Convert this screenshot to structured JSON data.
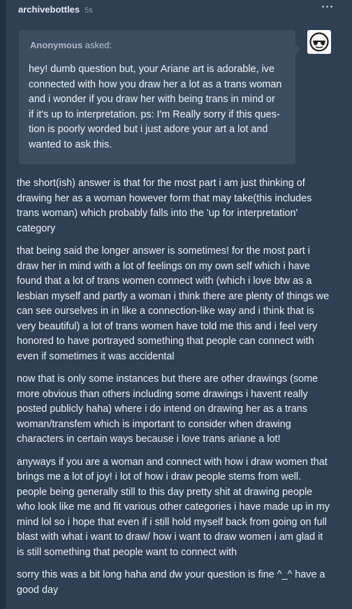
{
  "post": {
    "username": "archivebottles",
    "timestamp": "5s"
  },
  "ask": {
    "asker": "Anonymous",
    "asked_suffix": "asked:",
    "question_lines": [
      "hey! dumb question but, your Ariane art is adorable, ive",
      "connected with how you draw her a lot as a trans woman",
      "and i wonder if you draw her with being trans in mind or",
      "if it's up to interpretation. ps: I'm Really sorry if this ques-",
      "tion is poorly worded but i just adore your art a lot and",
      "wanted to ask this."
    ]
  },
  "answer": {
    "paragraphs": [
      [
        "the short(ish) answer is that for the most part i am just thinking of",
        "drawing her as a woman however form that may take(this includes",
        "trans woman) which probably falls into the 'up for interpretation'",
        "category"
      ],
      [
        "that being said the longer answer is sometimes! for the most part i",
        "draw her in mind with a lot of feelings on my own self which i have",
        "found that a lot of trans women connect with (which i love btw as a",
        "lesbian myself and partly a woman i think there are plenty of things we",
        "can see ourselves in in like a connection-like way and i think that is",
        "very beautiful) a lot of trans women have told me this and i feel very",
        "honored to have portrayed something that people can connect with",
        "even if sometimes it was accidental"
      ],
      [
        "now that is only some instances but there are other drawings (some",
        "more obvious than others including some drawings i havent really",
        "posted publicly haha) where i do intend on drawing her as a trans",
        "woman/transfem which is important to consider when drawing",
        "characters in certain ways because i love trans ariane a lot!"
      ],
      [
        "anyways if you are a woman and connect with how i draw women that",
        "brings me a lot of joy! i lot of how i draw people stems from well.",
        "people being generally still to this day pretty shit at drawing people",
        "who look like me and fit various other categories i have made up in my",
        "mind lol so i hope that even if i still hold myself back from going on full",
        "blast with what i want to draw/ how i want to draw women i am glad it",
        "is still something that people want to connect with"
      ],
      [
        "sorry this was a bit long haha and dw your question is fine ^_^ have a",
        "good day"
      ]
    ]
  },
  "icons": {
    "more": "ellipsis-icon",
    "avatar": "sunglasses-avatar-icon"
  },
  "colors": {
    "background": "#2b3a4b",
    "post_background": "#2f4054",
    "ask_background": "#3c4e62",
    "text": "#eef1f4",
    "muted": "#8c9aaa"
  }
}
